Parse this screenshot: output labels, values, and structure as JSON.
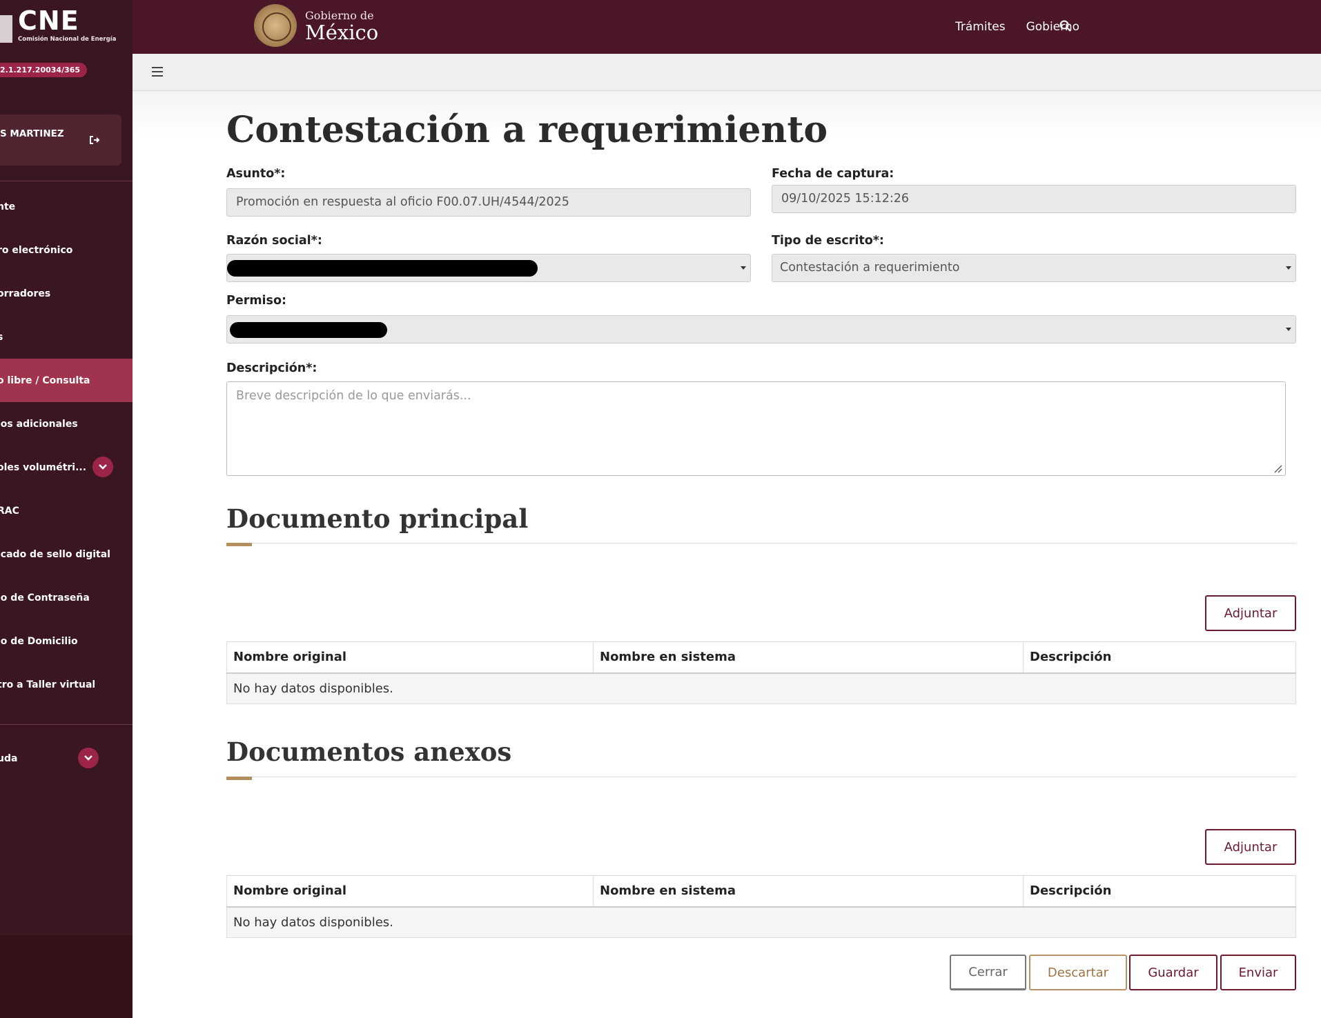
{
  "sidebar": {
    "brand_title": "CNE",
    "brand_sub": "Comisión Nacional de Energía",
    "version": "2.1.217.20034/365",
    "user_name": "S MARTINEZ",
    "items": [
      {
        "label": "nte"
      },
      {
        "label": "ro electrónico"
      },
      {
        "label": "orradores"
      },
      {
        "label": "s"
      },
      {
        "label": "o libre / Consulta"
      },
      {
        "label": "ios adicionales"
      },
      {
        "label": "oles volumétri..."
      },
      {
        "label": "RAC"
      },
      {
        "label": "icado de sello digital"
      },
      {
        "label": "io de Contraseña"
      },
      {
        "label": "io de Domicilio"
      },
      {
        "label": "tro a Taller virtual"
      }
    ],
    "help_label": "uda"
  },
  "topbar": {
    "gob_small": "Gobierno de",
    "gob_big": "México",
    "links": [
      "Trámites",
      "Gobierno"
    ]
  },
  "main": {
    "title": "Contestación a requerimiento",
    "asunto_label": "Asunto*:",
    "asunto_value": "Promoción en respuesta al oficio F00.07.UH/4544/2025",
    "fecha_label": "Fecha de captura:",
    "fecha_value": "09/10/2025 15:12:26",
    "razon_label": "Razón social*:",
    "tipo_label": "Tipo de escrito*:",
    "tipo_value": "Contestación a requerimiento",
    "permiso_label": "Permiso:",
    "descripcion_label": "Descripción*:",
    "descripcion_placeholder": "Breve descripción de lo que enviarás...",
    "doc_principal_title": "Documento principal",
    "doc_anexos_title": "Documentos anexos",
    "adjuntar_label": "Adjuntar",
    "table_headers": [
      "Nombre original",
      "Nombre en sistema",
      "Descripción"
    ],
    "empty_text": "No hay datos disponibles.",
    "buttons": {
      "cerrar": "Cerrar",
      "descartar": "Descartar",
      "guardar": "Guardar",
      "enviar": "Enviar"
    }
  },
  "colors": {
    "sidebar_bg": "#3a1620",
    "header_bg": "#4a1628",
    "accent": "#9d2449",
    "gold": "#b58e5d"
  }
}
